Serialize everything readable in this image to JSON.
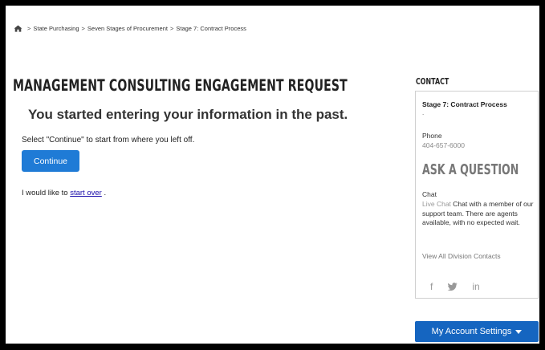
{
  "breadcrumb": {
    "items": [
      "State Purchasing",
      "Seven Stages of Procurement",
      "Stage 7: Contract Process"
    ],
    "separator": ">"
  },
  "main": {
    "title": "MANAGEMENT CONSULTING ENGAGEMENT REQUEST",
    "subtitle": "You started entering your information in the past.",
    "instruction": "Select \"Continue\" to start from where you left off.",
    "continue_label": "Continue",
    "startover_prefix": "I would like to",
    "startover_link": "start over",
    "startover_suffix": "."
  },
  "sidebar": {
    "heading": "CONTACT",
    "stage_title": "Stage 7: Contract Process",
    "stage_dot": ".",
    "phone_label": "Phone",
    "phone_number": "404-657-6000",
    "ask_heading": "ASK A QUESTION",
    "chat_label": "Chat",
    "chat_link": "Live Chat",
    "chat_message": "Chat with a member of our support team. There are agents available, with no expected wait.",
    "division_link": "View All Division Contacts",
    "social": [
      "f",
      "twitter",
      "in"
    ]
  },
  "account": {
    "label": "My Account Settings"
  },
  "colors": {
    "primary_button": "#1f7bd6",
    "account_button": "#1565c0",
    "link": "#1a0dab"
  }
}
